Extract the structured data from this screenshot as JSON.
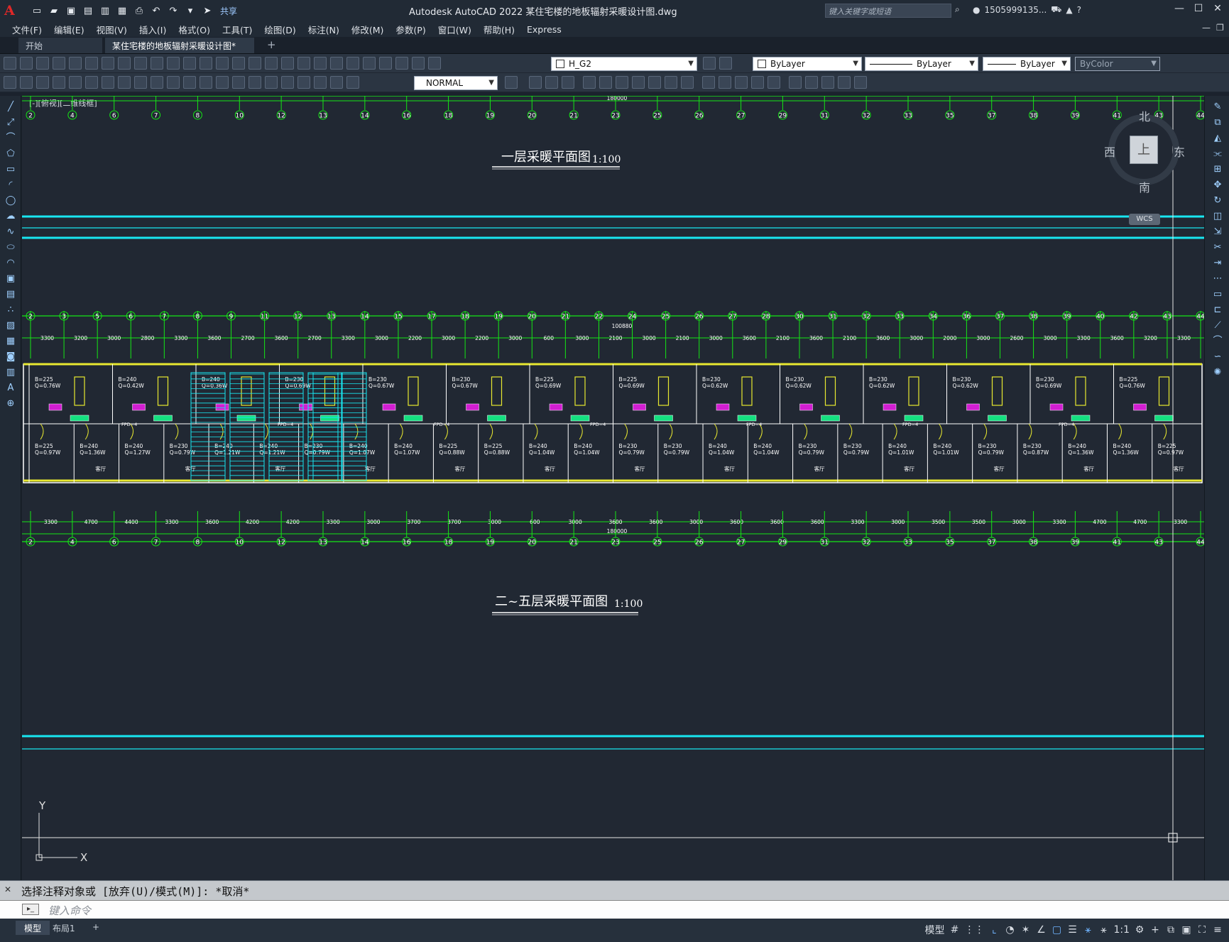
{
  "app": {
    "logo": "A",
    "title": "Autodesk AutoCAD 2022    某住宅楼的地板辐射采暖设计图.dwg",
    "share": "共享",
    "search_placeholder": "键入关键字或短语",
    "user": "1505999135...",
    "help": "?"
  },
  "menu": [
    "文件(F)",
    "编辑(E)",
    "视图(V)",
    "插入(I)",
    "格式(O)",
    "工具(T)",
    "绘图(D)",
    "标注(N)",
    "修改(M)",
    "参数(P)",
    "窗口(W)",
    "帮助(H)",
    "Express"
  ],
  "tabs": [
    {
      "label": "开始"
    },
    {
      "label": "某住宅楼的地板辐射采暖设计图*"
    }
  ],
  "toolbar": {
    "layer": "H_G2",
    "color": "ByLayer",
    "linetype": "ByLayer",
    "lineweight": "ByLayer",
    "plotstyle": "ByColor",
    "dimstyle": "NORMAL"
  },
  "viewport": {
    "label": "[-][俯视][二维线框]",
    "compass": {
      "n": "北",
      "s": "南",
      "e": "东",
      "w": "西",
      "top": "上"
    },
    "wcs": "WCS",
    "ucs_x": "X",
    "ucs_y": "Y"
  },
  "drawing": {
    "title1": "一层采暖平面图",
    "scale1": "1:100",
    "title2": "二~五层采暖平面图",
    "scale2": "1:100",
    "total_dim": "180000",
    "total_dim2": "100880",
    "top_axes": [
      "2",
      "4",
      "6",
      "7",
      "8",
      "10",
      "12",
      "13",
      "14",
      "16",
      "18",
      "19",
      "20",
      "21",
      "23",
      "25",
      "26",
      "27",
      "29",
      "31",
      "32",
      "33",
      "35",
      "37",
      "38",
      "39",
      "41",
      "43",
      "44"
    ],
    "mid_axes": [
      "2",
      "3",
      "5",
      "6",
      "7",
      "8",
      "9",
      "11",
      "12",
      "13",
      "14",
      "15",
      "17",
      "18",
      "19",
      "20",
      "21",
      "22",
      "24",
      "25",
      "26",
      "27",
      "28",
      "30",
      "31",
      "32",
      "33",
      "34",
      "36",
      "37",
      "38",
      "39",
      "40",
      "42",
      "43",
      "44"
    ],
    "mid_dims": [
      "3300",
      "3200",
      "3000",
      "2800",
      "3300",
      "3600",
      "2700",
      "3600",
      "2700",
      "3300",
      "3000",
      "2200",
      "3000",
      "2200",
      "3000",
      "600",
      "3000",
      "2100",
      "3000",
      "2100",
      "3000",
      "3600",
      "2100",
      "3600",
      "2100",
      "3600",
      "3000",
      "2000",
      "3000",
      "2600",
      "3000",
      "3300",
      "3600",
      "3200",
      "3300"
    ],
    "bottom_dims": [
      "3300",
      "4700",
      "4400",
      "3300",
      "3600",
      "4200",
      "4200",
      "3300",
      "3000",
      "3700",
      "3700",
      "3000",
      "600",
      "3000",
      "3600",
      "3600",
      "3000",
      "3600",
      "3600",
      "3600",
      "3300",
      "3000",
      "3500",
      "3500",
      "3000",
      "3300",
      "4700",
      "4700",
      "3300"
    ],
    "bottom_axes": [
      "2",
      "4",
      "6",
      "7",
      "8",
      "10",
      "12",
      "13",
      "14",
      "16",
      "18",
      "19",
      "20",
      "21",
      "23",
      "25",
      "26",
      "27",
      "29",
      "31",
      "32",
      "33",
      "35",
      "37",
      "38",
      "39",
      "41",
      "43",
      "44"
    ],
    "rooms_top": [
      "B=225 Q=0.76W",
      "B=240 Q=0.42W",
      "B=240 Q=0.36W",
      "B=230 Q=0.69W",
      "B=230 Q=0.67W",
      "B=230 Q=0.67W",
      "B=225 Q=0.69W",
      "B=225 Q=0.69W",
      "B=230 Q=0.62W",
      "B=230 Q=0.62W",
      "B=230 Q=0.62W",
      "B=230 Q=0.62W",
      "B=230 Q=0.69W",
      "B=225 Q=0.76W"
    ],
    "rooms_bottom": [
      "B=225 Q=0.97W",
      "B=240 Q=1.36W",
      "B=240 Q=1.27W",
      "B=230 Q=0.79W",
      "B=240 Q=1.21W",
      "B=240 Q=1.21W",
      "B=230 Q=0.79W",
      "B=240 Q=1.07W",
      "B=240 Q=1.07W",
      "B=225 Q=0.88W",
      "B=225 Q=0.88W",
      "B=240 Q=1.04W",
      "B=240 Q=1.04W",
      "B=230 Q=0.79W",
      "B=230 Q=0.79W",
      "B=240 Q=1.04W",
      "B=240 Q=1.04W",
      "B=230 Q=0.79W",
      "B=230 Q=0.79W",
      "B=240 Q=1.01W",
      "B=240 Q=1.01W",
      "B=230 Q=0.79W",
      "B=230 Q=0.87W",
      "B=240 Q=1.36W",
      "B=240 Q=1.36W",
      "B=225 Q=0.97W"
    ],
    "room_label": "客厅",
    "fpd": "FPD=4"
  },
  "command": {
    "history": "选择注释对象或 [放弃(U)/模式(M)]: *取消*",
    "placeholder": "键入命令"
  },
  "status": {
    "model_tab": "模型",
    "layout_tab": "布局1",
    "model_btn": "模型",
    "scale": "1:1"
  }
}
